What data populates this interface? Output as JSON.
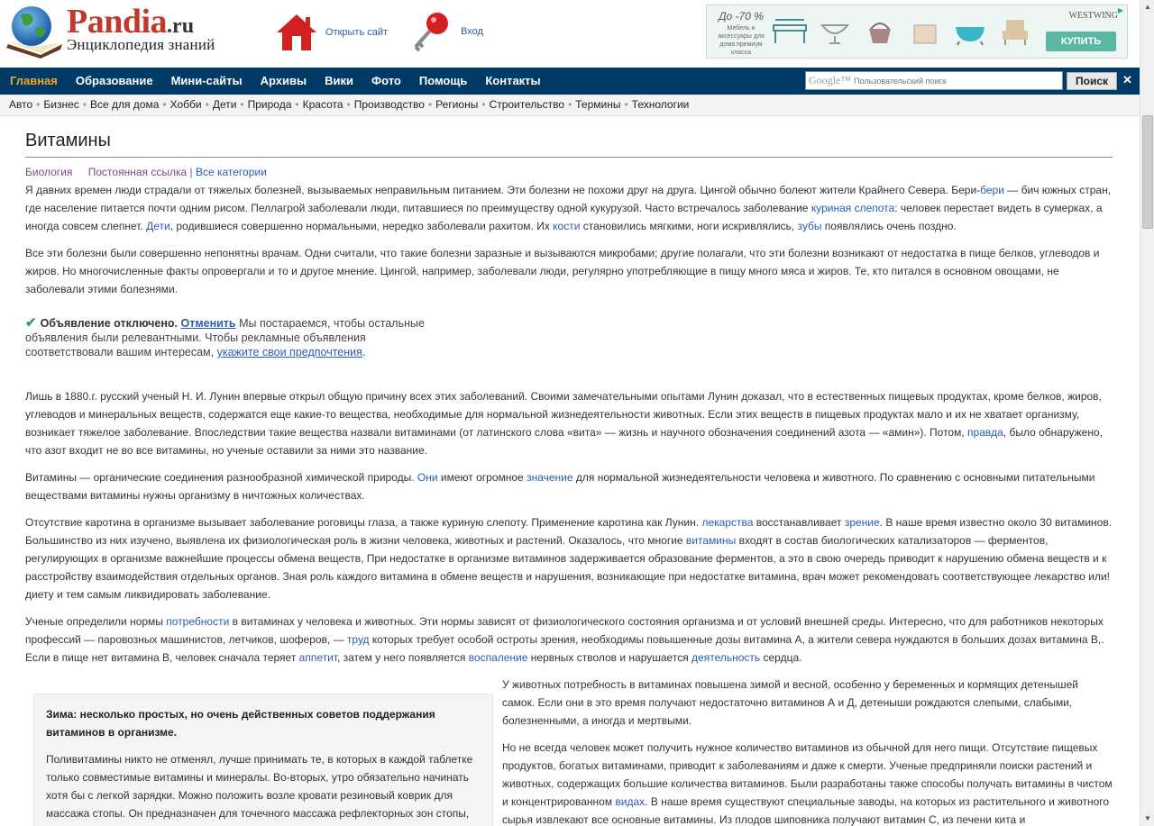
{
  "header": {
    "brand_name": "Pandia",
    "brand_tld": ".ru",
    "brand_sub": "Энциклопедия знаний",
    "open_site": "Открыть сайт",
    "login": "Вход"
  },
  "ad_banner": {
    "promo": "До -70 %",
    "promo_sub": "Мебель и аксессуары для дома премиум класса",
    "brand": "WESTWING",
    "buy": "КУПИТЬ"
  },
  "nav": {
    "items": [
      "Главная",
      "Образование",
      "Мини-сайты",
      "Архивы",
      "Вики",
      "Фото",
      "Помощь",
      "Контакты"
    ],
    "search_prefix": "Google™",
    "search_placeholder": "Пользовательский поиск",
    "search_button": "Поиск",
    "close": "✕"
  },
  "subnav": [
    "Авто",
    "Бизнес",
    "Все для дома",
    "Хобби",
    "Дети",
    "Природа",
    "Красота",
    "Производство",
    "Регионы",
    "Строительство",
    "Термины",
    "Технологии"
  ],
  "article": {
    "title": "Витамины",
    "category": "Биология",
    "permalink": "Постоянная ссылка",
    "sep": "|",
    "all_categories": "Все категории",
    "p1": {
      "a": "Я давних времен люди страдали от тяжелых болезней, вызываемых неправильным питанием. Эти болезни не похожи друг на друга. Цингой обычно болеют жители Крайнего Севера. Бери-",
      "l1": "бери",
      "b": " — бич южных стран, где население питается почти одним рисом. Пеллагрой заболевали люди, питавшиеся по преимуществу одной кукурузой. Часто встречалось заболевание ",
      "l2": "куриная слепота",
      "c": ": человек перестает видеть в сумерках, а иногда совсем слепнет. ",
      "l3": "Дети",
      "d": ", родившиеся совершенно нормальными, нередко заболевали рахитом. Их ",
      "l4": "кости",
      "e": " становились мягкими, ноги искривлялись, ",
      "l5": "зубы",
      "f": " появлялись очень поздно."
    },
    "p2": "Все эти болезни были совершенно непонятны врачам. Одни считали, что такие болезни заразные и вызываются микробами; другие полагали, что эти болезни возникают от недостатка в пище белков, углеводов и жиров. Но многочисленные факты опровергали и то и другое мнение. Цингой, например, заболевали люди, регулярно употребляющие в пищу много мяса и жиров. Те, кто питался в основном овощами, не заболевали этими болезнями.",
    "ad_notice": {
      "check": "✔",
      "title": "Объявление отключено.",
      "cancel": "Отменить",
      "text": " Мы постараемся, чтобы остальные объявления были релевантными. Чтобы рекламные объявления соответствовали вашим интересам, ",
      "link": "укажите свои предпочтения",
      "end": "."
    },
    "p3": {
      "a": "Лишь в 1880.г. русский ученый Н. И. Лунин впервые открыл общую причину всех этих заболеваний. Своими замечательными опытами Лунин доказал, что в естественных пищевых продуктах, кроме белков, жиров, углеводов и минеральных веществ, содержатся еще какие-то вещества, необходимые для нормальной жизнедеятельности животных. Если этих веществ в пищевых продуктах мало и их не хватает организму, возникает тяжелое заболевание. Впоследствии такие вещества назвали витаминами (от латинского слова «вита» — жизнь и научного обозначения соединений азота — «амин»). Потом, ",
      "l1": "правда",
      "b": ", было обнаружено, что азот входит не во все витамины, но ученые оставили за ними это название."
    },
    "p4": {
      "a": "Витамины — органические соединения разнообразной химической природы. ",
      "l1": "Они",
      "b": " имеют огромное ",
      "l2": "значение",
      "c": " для нормальной жизнедеятельности человека и животного. По сравнению с основными питательными веществами витамины нужны организму в ничтожных количествах."
    },
    "p5": {
      "a": "Отсутствие каротина в организме вызывает заболевание роговицы глаза, а также куриную слепоту. Применение каротина как Лунин. ",
      "l1": "лекарства",
      "b": " восстанавливает ",
      "l2": "зрение",
      "c": ". В наше время известно около 30 витаминов. Большинство из них изучено, выявлена их физиологическая роль в жизни человека, животных и растений. Оказалось, что многие ",
      "l3": "витамины",
      "d": " входят в состав биологических катализаторов — ферментов, регулирующих в организме важнейшие процессы обмена веществ, При недостатке в организме витаминов задерживается образование ферментов, а это в свою очередь приводит к нарушению обмена веществ и к расстройству взаимодействия отдельных органов. Зная роль каждого витамина в обмене веществ и нарушения, возникающие при недостатке витамина, врач может рекомендовать соответствующее лекарство или! диету и тем самым ликвидировать заболевание."
    },
    "p6": {
      "a": "Ученые определили нормы ",
      "l1": "потребности",
      "b": " в витаминах у человека и животных. Эти нормы зависят от физиологического состояния организма и от условий внешней среды. Интересно, что для работников некоторых профессий — паровозных машинистов, летчиков, шоферов, — ",
      "l2": "труд",
      "c": " которых требует особой остроты зрения, необходимы повышенные дозы витамина А, а жители севера нуждаются в больших дозах витамина В,. Если в пище нет витамина В, человек сначала теряет ",
      "l3": "аппетит",
      "d": ", затем у него появляется ",
      "l4": "воспаление",
      "e": " нервных стволов и нарушается ",
      "l5": "деятельность",
      "f": " сердца."
    },
    "tip": {
      "title": "Зима: несколько простых, но очень действенных советов поддержания витаминов в организме.",
      "text": "Поливитамины никто не отменял, лучше принимать те, в которых в каждой таблетке только совместимые витамины и минералы. Во-вторых, утро обязательно начинать хотя бы с легкой зарядки. Можно положить возле кровати резиновый коврик для массажа стопы. Он предназначен для точечного массажа рефлекторных зон стопы, лечения и профилактики плоскостопия, укрепления мышечно-связочного аппарата"
    },
    "p7": "У животных потребность в витаминах повышена зимой и весной, особенно у беременных и кормящих детенышей самок. Если они в это время получают недостаточно витаминов А и Д, детеныши рождаются слепыми, слабыми, болезненными, а иногда и мертвыми.",
    "p8": {
      "a": "Но не всегда человек может получить нужное количество витаминов из обычной для него пищи. Отсутствие пищевых продуктов, богатых витаминами, приводит к заболеваниям и даже к смерти. Ученые предприняли поиски растений и животных, содержащих большие количества витаминов. Были разработаны также способы получать витамины в чистом и концентрированном ",
      "l1": "видах",
      "b": ". В наше время существуют специальные заводы, на которых из растительного и животного сырья извлекают все основные витамины. Из плодов шиповника получают витамин С, из печени кита и"
    }
  },
  "colors": {
    "nav_bg": "#003a66",
    "nav_active": "#f7a520",
    "link": "#2a5db0",
    "brand_red": "#c0392b",
    "buy_button": "#5cb6a4"
  }
}
